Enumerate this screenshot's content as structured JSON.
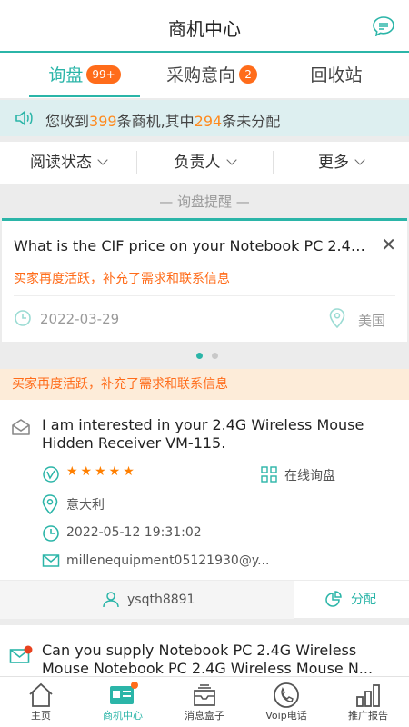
{
  "header": {
    "title": "商机中心",
    "message_icon": "chat-bubble-icon"
  },
  "tabs": [
    {
      "label": "询盘",
      "badge": "99+"
    },
    {
      "label": "采购意向",
      "badge": "2"
    },
    {
      "label": "回收站"
    }
  ],
  "notice": {
    "prefix": "您收到",
    "total": "399",
    "middle": "条商机,其中",
    "unassigned": "294",
    "suffix": "条未分配"
  },
  "filters": [
    {
      "label": "阅读状态"
    },
    {
      "label": "负责人"
    },
    {
      "label": "更多"
    }
  ],
  "reminder": {
    "heading": "— 询盘提醒 —",
    "question": "What is the CIF price on your Notebook PC 2.4G W...",
    "note": "买家再度活跃，补充了需求和联系信息",
    "date": "2022-03-29",
    "country": "美国"
  },
  "banner": "买家再度活跃，补充了需求和联系信息",
  "inquiry": {
    "title": "I am interested in your 2.4G Wireless Mouse Hidden Receiver VM-115.",
    "rating": 5,
    "stars": "★★★★★",
    "channel": "在线询盘",
    "country": "意大利",
    "datetime": "2022-05-12 19:31:02",
    "email": "millenequipment05121930@y...",
    "assignee": "ysqth8891",
    "assign_label": "分配"
  },
  "inquiry2": {
    "title": "Can you supply Notebook PC 2.4G Wireless Mouse Notebook PC 2.4G Wireless Mouse N..."
  },
  "nav": [
    {
      "label": "主页"
    },
    {
      "label": "商机中心"
    },
    {
      "label": "消息盒子"
    },
    {
      "label": "Voip电话"
    },
    {
      "label": "推广报告"
    }
  ],
  "colors": {
    "accent": "#2bb5a8",
    "orange": "#ff6c1a",
    "badge": "#ff6c1a"
  }
}
